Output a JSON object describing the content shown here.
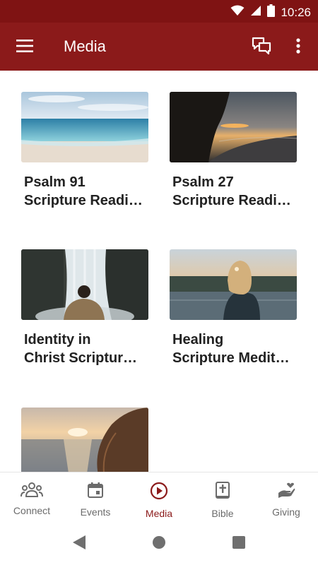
{
  "status_bar": {
    "time": "10:26",
    "icons": [
      "wifi-icon",
      "signal-icon",
      "battery-icon"
    ]
  },
  "app_bar": {
    "title": "Media",
    "icons": [
      "menu-icon",
      "chat-icon",
      "more-vert-icon"
    ]
  },
  "media": {
    "items": [
      {
        "line1": "Psalm 91",
        "line2": "Scripture Readi…",
        "image": "calm sea under blue sky"
      },
      {
        "line1": "Psalm 27",
        "line2": "Scripture Readi…",
        "image": "sunset over shoreline"
      },
      {
        "line1": "Identity in",
        "line2": "Christ Scriptur…",
        "image": "person facing waterfall"
      },
      {
        "line1": "Healing",
        "line2": "Scripture Medit…",
        "image": "woman at lake at dusk"
      },
      {
        "line1": "",
        "line2": "",
        "image": "woman by the sea at sunset"
      }
    ]
  },
  "bottom_nav": {
    "items": [
      {
        "label": "Connect",
        "icon": "people-icon"
      },
      {
        "label": "Events",
        "icon": "calendar-icon"
      },
      {
        "label": "Media",
        "icon": "play-circle-icon",
        "active": true
      },
      {
        "label": "Bible",
        "icon": "bible-icon"
      },
      {
        "label": "Giving",
        "icon": "giving-hand-icon"
      }
    ]
  },
  "system_nav": {
    "icons": [
      "back-icon",
      "home-icon",
      "recents-icon"
    ]
  },
  "colors": {
    "primary": "#8b1a1a",
    "status_bar": "#7f1313",
    "nav_inactive": "#6b6b6b",
    "text": "#222222"
  }
}
